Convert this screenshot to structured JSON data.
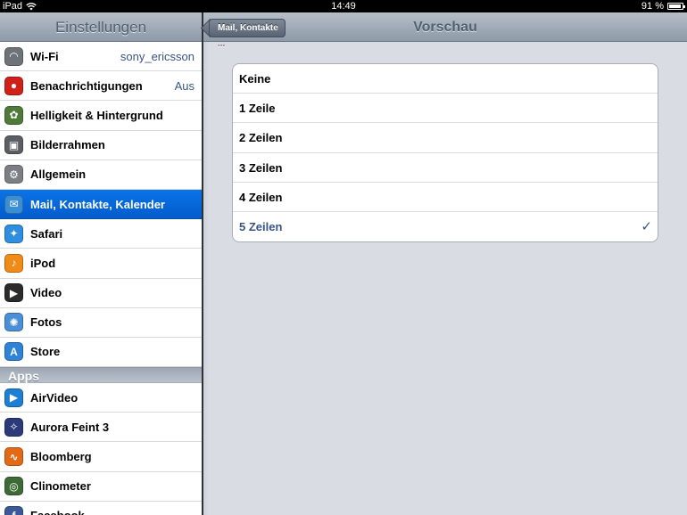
{
  "status_bar": {
    "device": "iPad",
    "time": "14:49",
    "battery": "91 %",
    "battery_level": 0.91
  },
  "sidebar": {
    "title": "Einstellungen",
    "items": [
      {
        "label": "Wi-Fi",
        "value": "sony_ericsson",
        "icon": "wifi-icon",
        "color": "#6e737a"
      },
      {
        "label": "Benachrichtigungen",
        "value": "Aus",
        "icon": "notifications-icon",
        "color": "#d0201a"
      },
      {
        "label": "Helligkeit & Hintergrund",
        "value": "",
        "icon": "brightness-icon",
        "color": "#4f7b3a"
      },
      {
        "label": "Bilderrahmen",
        "value": "",
        "icon": "picture-frame-icon",
        "color": "#5b5e63"
      },
      {
        "label": "Allgemein",
        "value": "",
        "icon": "gear-icon",
        "color": "#7b7f85"
      },
      {
        "label": "Mail, Kontakte, Kalender",
        "value": "",
        "icon": "mail-icon",
        "color": "#3b8ed4",
        "selected": true
      },
      {
        "label": "Safari",
        "value": "",
        "icon": "safari-icon",
        "color": "#2f8ee0"
      },
      {
        "label": "iPod",
        "value": "",
        "icon": "ipod-icon",
        "color": "#f08b18"
      },
      {
        "label": "Video",
        "value": "",
        "icon": "video-icon",
        "color": "#2b2b2b"
      },
      {
        "label": "Fotos",
        "value": "",
        "icon": "photos-icon",
        "color": "#4a8fd8"
      },
      {
        "label": "Store",
        "value": "",
        "icon": "store-icon",
        "color": "#2f83d6"
      }
    ],
    "apps_header": "Apps",
    "apps": [
      {
        "label": "AirVideo",
        "icon": "airvideo-icon",
        "color": "#1c7fd3"
      },
      {
        "label": "Aurora Feint 3",
        "icon": "aurora-feint-icon",
        "color": "#2b3a78"
      },
      {
        "label": "Bloomberg",
        "icon": "bloomberg-icon",
        "color": "#e26a17"
      },
      {
        "label": "Clinometer",
        "icon": "clinometer-icon",
        "color": "#3d6b36"
      },
      {
        "label": "Facebook",
        "icon": "facebook-icon",
        "color": "#3b5998"
      }
    ]
  },
  "detail": {
    "back_label": "Mail, Kontakte ...",
    "title": "Vorschau",
    "options": [
      {
        "label": "Keine",
        "checked": false
      },
      {
        "label": "1 Zeile",
        "checked": false
      },
      {
        "label": "2 Zeilen",
        "checked": false
      },
      {
        "label": "3 Zeilen",
        "checked": false
      },
      {
        "label": "4 Zeilen",
        "checked": false
      },
      {
        "label": "5 Zeilen",
        "checked": true
      }
    ],
    "checkmark": "✓"
  }
}
